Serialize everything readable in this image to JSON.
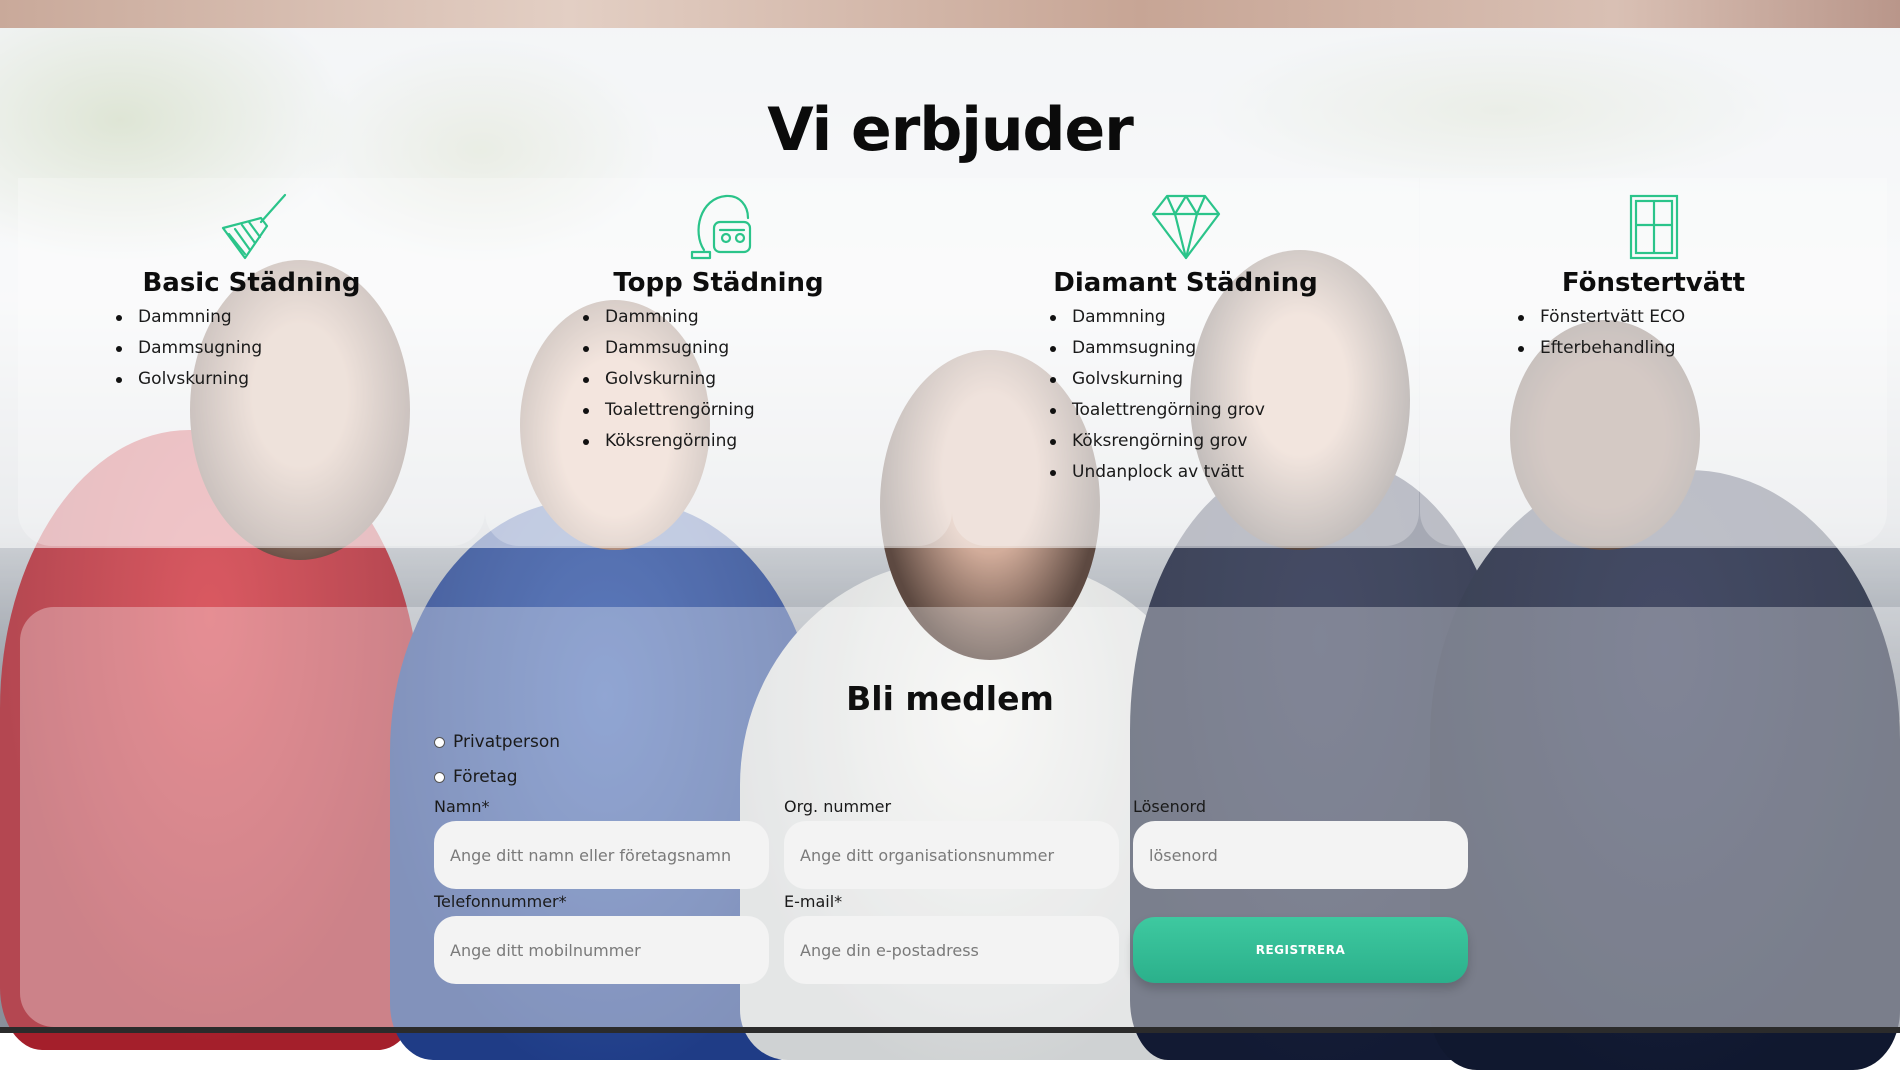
{
  "page": {
    "title": "Vi erbjuder",
    "accent_color": "#2bc48a"
  },
  "services": [
    {
      "icon": "broom-icon",
      "title": "Basic Städning",
      "items": [
        "Dammning",
        "Dammsugning",
        "Golvskurning"
      ]
    },
    {
      "icon": "vacuum-cleaner-icon",
      "title": "Topp Städning",
      "items": [
        "Dammning",
        "Dammsugning",
        "Golvskurning",
        "Toalettrengörning",
        "Köksrengörning"
      ]
    },
    {
      "icon": "diamond-icon",
      "title": "Diamant Städning",
      "items": [
        "Dammning",
        "Dammsugning",
        "Golvskurning",
        "Toalettrengörning grov",
        "Köksrengörning grov",
        "Undanplock av tvätt"
      ]
    },
    {
      "icon": "window-icon",
      "title": "Fönstertvätt",
      "items": [
        "Fönstertvätt ECO",
        "Efterbehandling"
      ]
    }
  ],
  "member_form": {
    "title": "Bli medlem",
    "account_types": [
      "Privatperson",
      "Företag"
    ],
    "fields": {
      "name": {
        "label": "Namn*",
        "placeholder": "Ange ditt namn eller företagsnamn"
      },
      "org": {
        "label": "Org. nummer",
        "placeholder": "Ange ditt organisationsnummer"
      },
      "password": {
        "label": "Lösenord",
        "placeholder": "lösenord"
      },
      "phone": {
        "label": "Telefonnummer*",
        "placeholder": "Ange ditt mobilnummer"
      },
      "email": {
        "label": "E-mail*",
        "placeholder": "Ange din e-postadress"
      }
    },
    "submit_label": "REGISTRERA"
  }
}
